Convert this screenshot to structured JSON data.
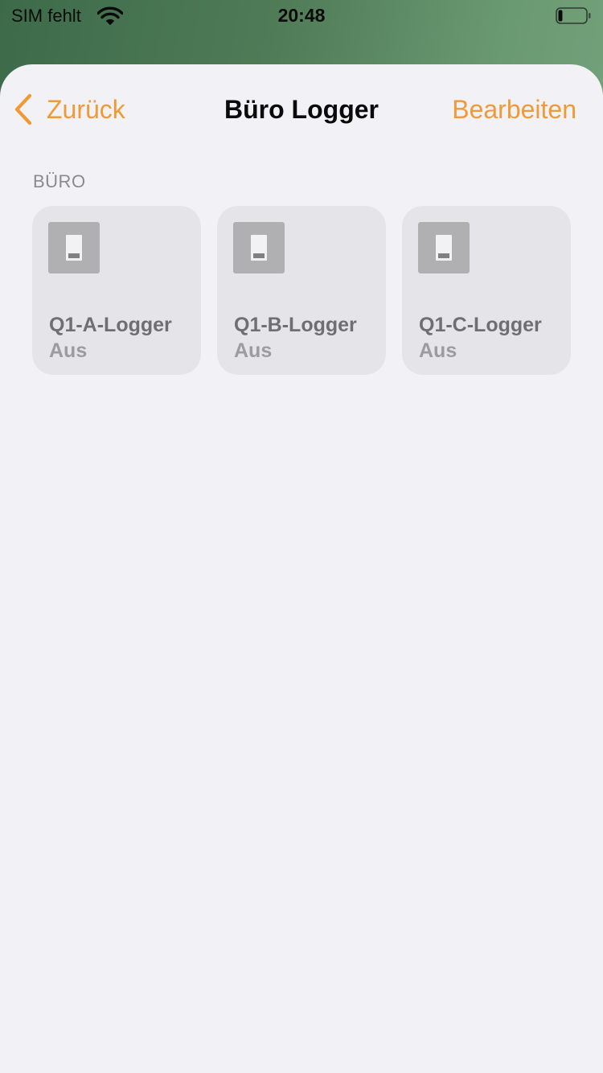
{
  "status_bar": {
    "carrier": "SIM fehlt",
    "time": "20:48",
    "battery_level": 0.15
  },
  "nav": {
    "back_label": "Zurück",
    "title": "Büro Logger",
    "edit_label": "Bearbeiten"
  },
  "section": {
    "header": "BÜRO",
    "accessories": [
      {
        "name": "Q1-A-Logger",
        "status": "Aus",
        "icon": "light-switch-icon"
      },
      {
        "name": "Q1-B-Logger",
        "status": "Aus",
        "icon": "light-switch-icon"
      },
      {
        "name": "Q1-C-Logger",
        "status": "Aus",
        "icon": "light-switch-icon"
      }
    ]
  },
  "colors": {
    "accent": "#f09a37",
    "sheet_background": "#f2f1f6",
    "tile_background": "#e5e4e9",
    "wallpaper": "#4f7b57"
  }
}
